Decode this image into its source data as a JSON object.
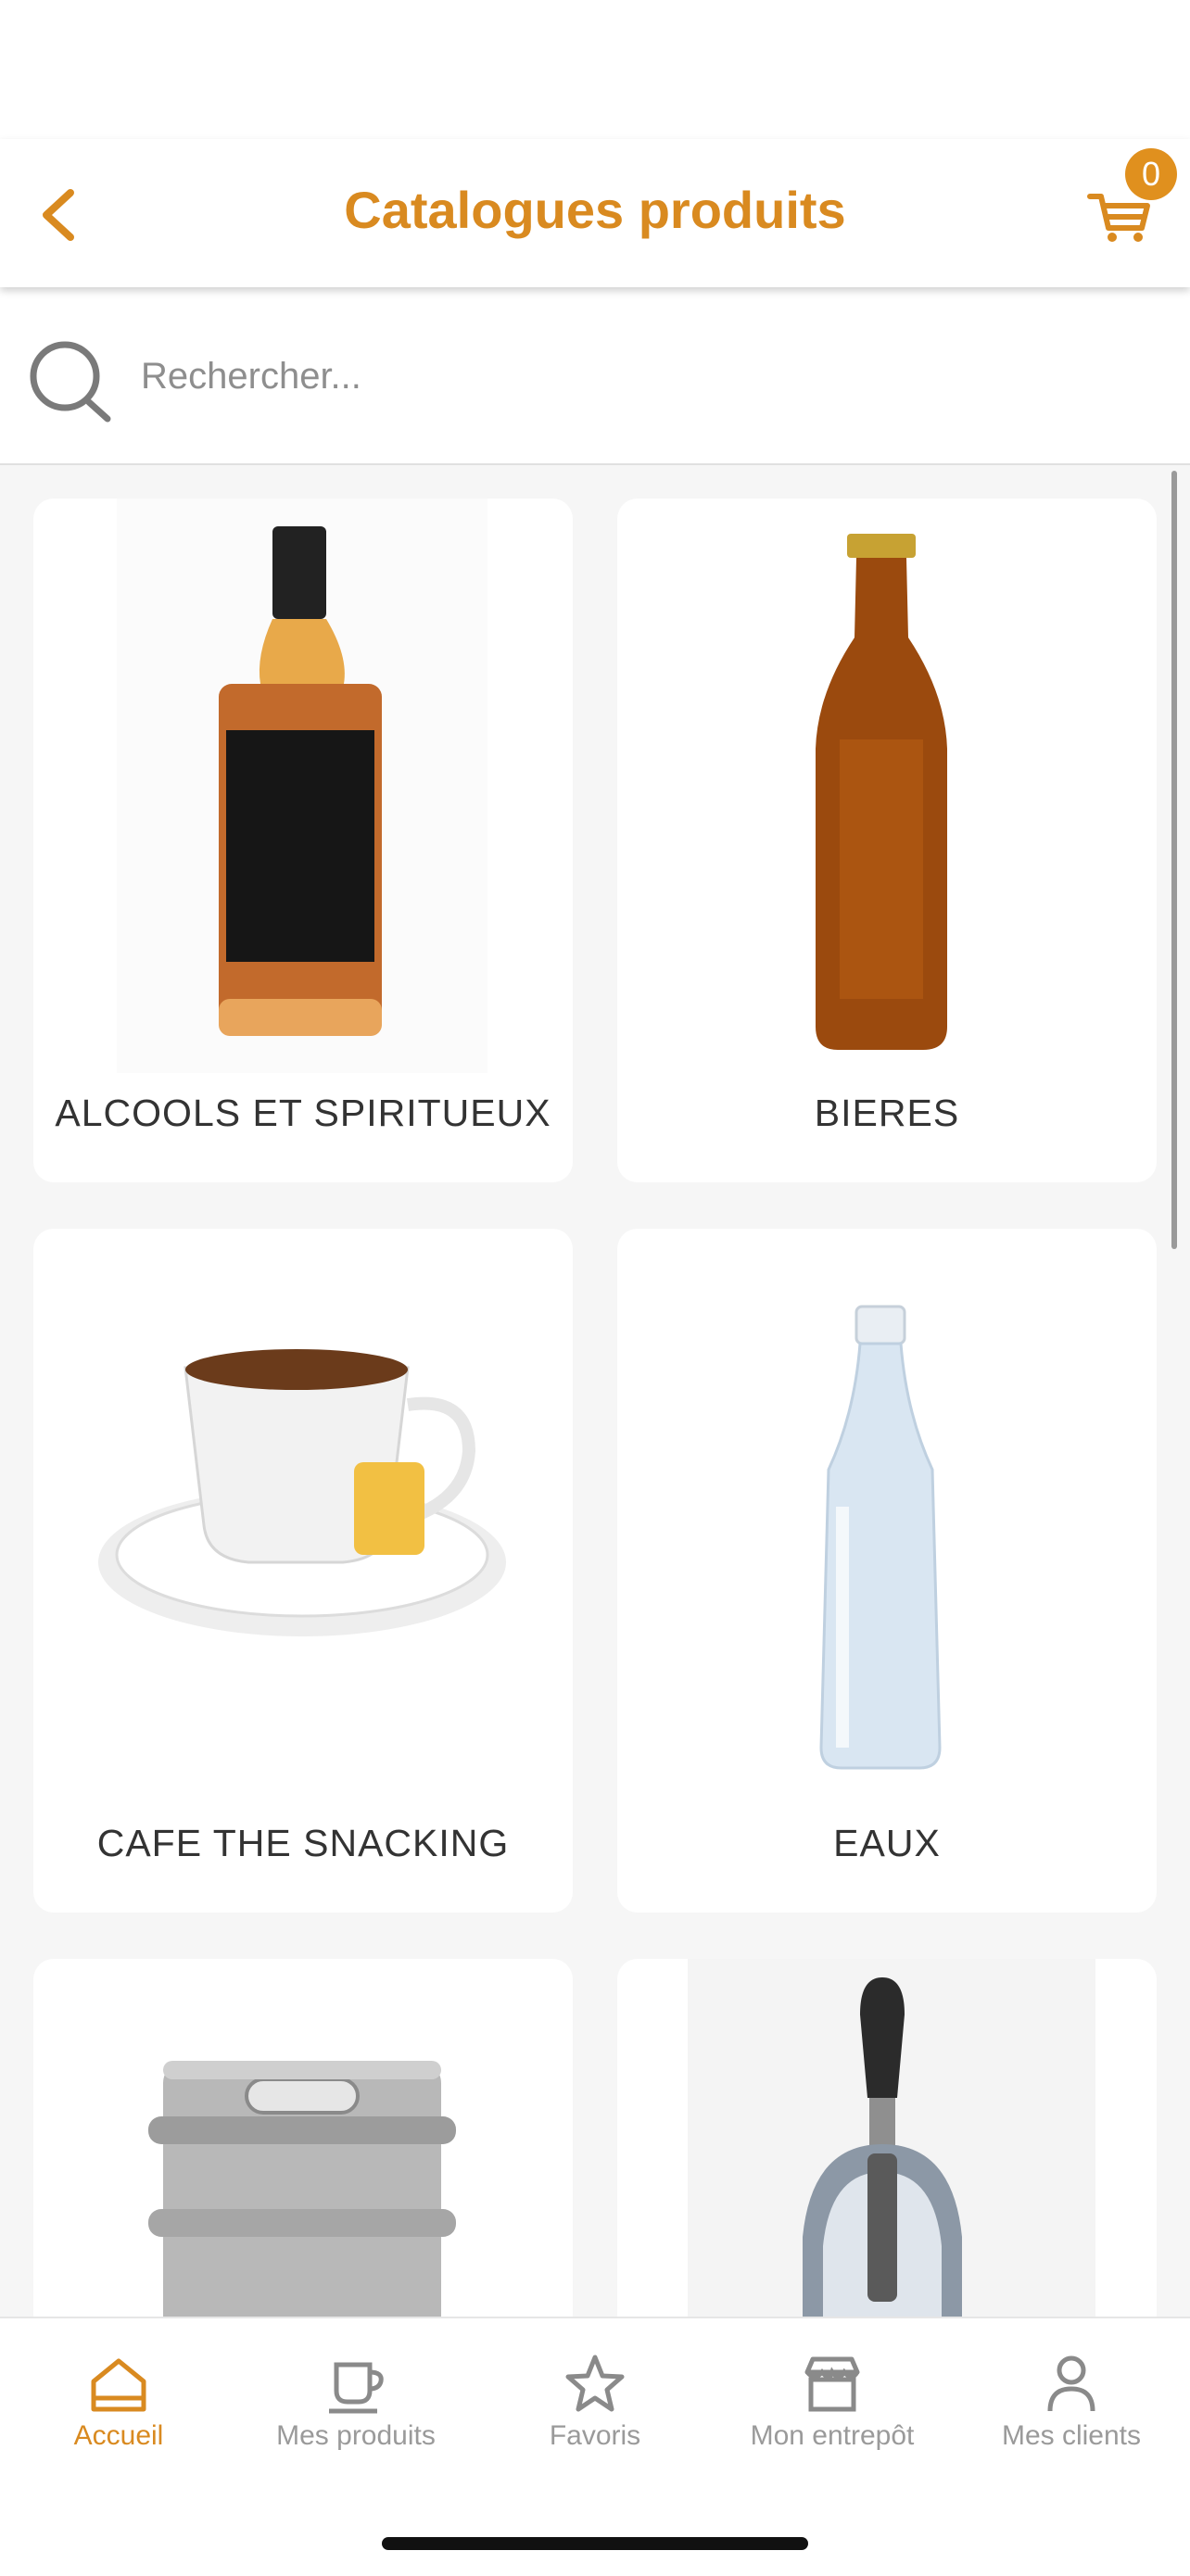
{
  "header": {
    "title": "Catalogues produits",
    "cart_count": "0",
    "accent_color": "#d98a20"
  },
  "search": {
    "placeholder": "Rechercher..."
  },
  "categories": [
    {
      "label": "ALCOOLS ET SPIRITUEUX",
      "icon": "whiskey-bottle-image"
    },
    {
      "label": "BIERES",
      "icon": "beer-bottle-image"
    },
    {
      "label": "CAFE THE SNACKING",
      "icon": "tea-cup-image"
    },
    {
      "label": "EAUX",
      "icon": "water-bottle-image"
    },
    {
      "label": "",
      "icon": "keg-image"
    },
    {
      "label": "",
      "icon": "beer-tap-image"
    }
  ],
  "tabbar": {
    "items": [
      {
        "label": "Accueil",
        "icon": "home-icon",
        "active": true
      },
      {
        "label": "Mes produits",
        "icon": "cup-icon",
        "active": false
      },
      {
        "label": "Favoris",
        "icon": "star-icon",
        "active": false
      },
      {
        "label": "Mon entrepôt",
        "icon": "store-icon",
        "active": false
      },
      {
        "label": "Mes clients",
        "icon": "user-icon",
        "active": false
      }
    ]
  }
}
